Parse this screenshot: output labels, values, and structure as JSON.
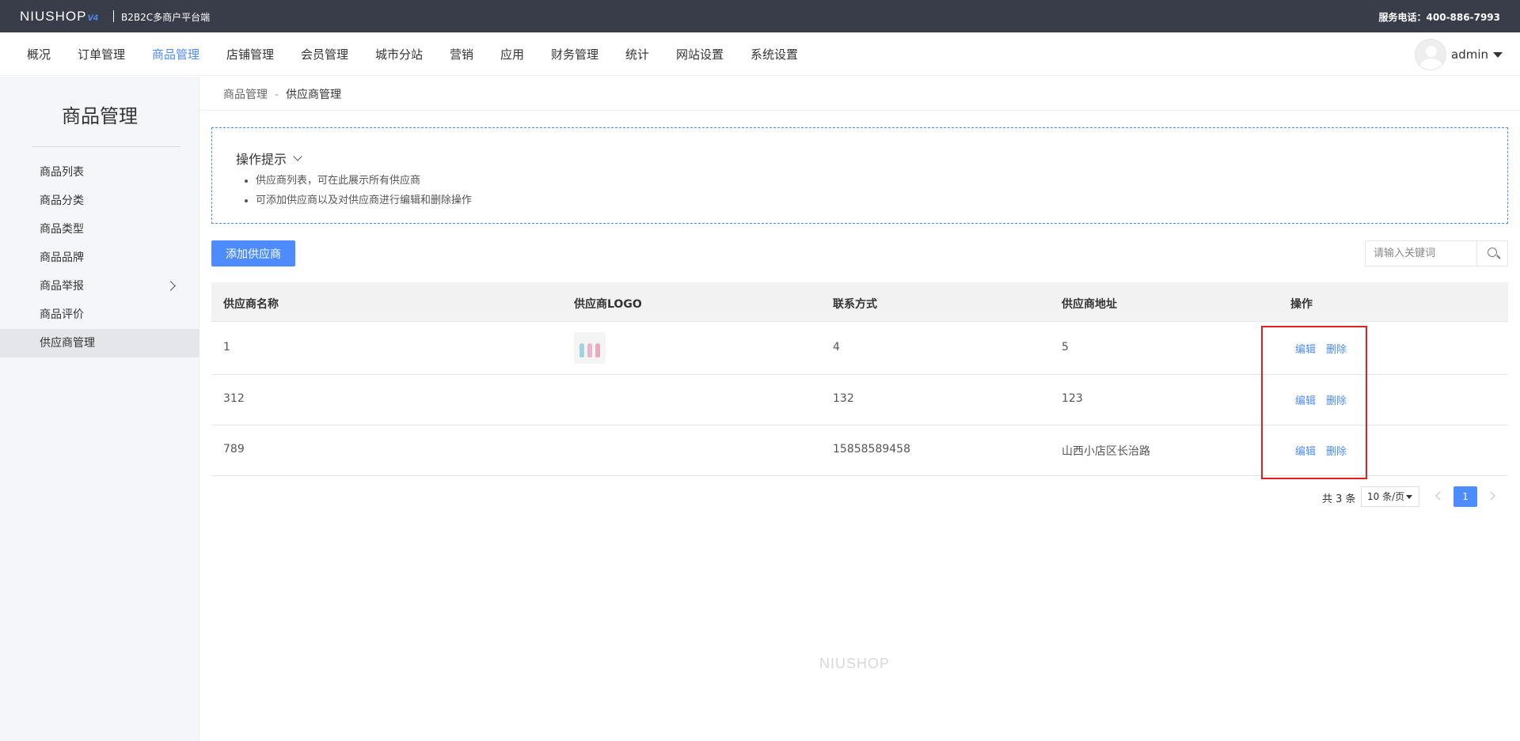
{
  "topbar": {
    "logo_text": "NIUSHOP",
    "logo_version": "V4",
    "platform": "B2B2C多商户平台端",
    "hotline": "服务电话：400-886-7993"
  },
  "nav": {
    "items": [
      "概况",
      "订单管理",
      "商品管理",
      "店铺管理",
      "会员管理",
      "城市分站",
      "营销",
      "应用",
      "财务管理",
      "统计",
      "网站设置",
      "系统设置"
    ],
    "active_index": 2,
    "username": "admin"
  },
  "sidebar": {
    "title": "商品管理",
    "items": [
      "商品列表",
      "商品分类",
      "商品类型",
      "商品品牌",
      "商品举报",
      "商品评价",
      "供应商管理"
    ],
    "active_index": 6
  },
  "breadcrumb": {
    "parent": "商品管理",
    "separator": "-",
    "current": "供应商管理"
  },
  "tips": {
    "title": "操作提示",
    "lines": [
      "供应商列表，可在此展示所有供应商",
      "可添加供应商以及对供应商进行编辑和删除操作"
    ]
  },
  "toolbar": {
    "add_label": "添加供应商",
    "search_placeholder": "请输入关键词"
  },
  "table": {
    "headers": [
      "供应商名称",
      "供应商LOGO",
      "联系方式",
      "供应商地址",
      "操作"
    ],
    "rows": [
      {
        "name": "1",
        "has_logo": true,
        "contact": "4",
        "address": "5"
      },
      {
        "name": "312",
        "has_logo": false,
        "contact": "132",
        "address": "123"
      },
      {
        "name": "789",
        "has_logo": false,
        "contact": "15858589458",
        "address": "山西小店区长治路"
      }
    ],
    "edit_label": "编辑",
    "delete_label": "删除"
  },
  "pagination": {
    "total_text": "共 3 条",
    "page_size": "10 条/页",
    "current_page": "1"
  },
  "footer": {
    "brand": "NIUSHOP"
  },
  "colors": {
    "accent": "#4d8cff",
    "topbar": "#393d49",
    "highlight": "#e02020"
  }
}
